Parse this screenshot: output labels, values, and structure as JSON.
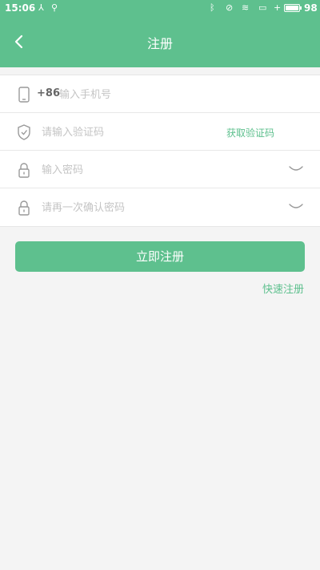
{
  "status_bar": {
    "time": "15:06",
    "battery_percent": "98",
    "battery_level": 0.98,
    "icons": [
      "usb-icon",
      "bluetooth-icon",
      "mute-icon",
      "wifi-icon",
      "screen-icon",
      "charging-icon"
    ]
  },
  "header": {
    "title": "注册",
    "back_icon": "chevron-left-icon"
  },
  "form": {
    "phone": {
      "prefix": "+86",
      "placeholder": "输入手机号",
      "icon": "phone-icon"
    },
    "code": {
      "placeholder": "请输入验证码",
      "action_label": "获取验证码",
      "icon": "shield-check-icon"
    },
    "password": {
      "placeholder": "输入密码",
      "icon": "lock-icon",
      "toggle_icon": "eye-closed-icon"
    },
    "confirm_password": {
      "placeholder": "请再一次确认密码",
      "icon": "lock-icon",
      "toggle_icon": "eye-closed-icon"
    }
  },
  "actions": {
    "submit_label": "立即注册",
    "quick_register_label": "快速注册"
  },
  "colors": {
    "primary": "#5ec08e",
    "background": "#f4f4f4",
    "placeholder": "#c4c4c4"
  }
}
